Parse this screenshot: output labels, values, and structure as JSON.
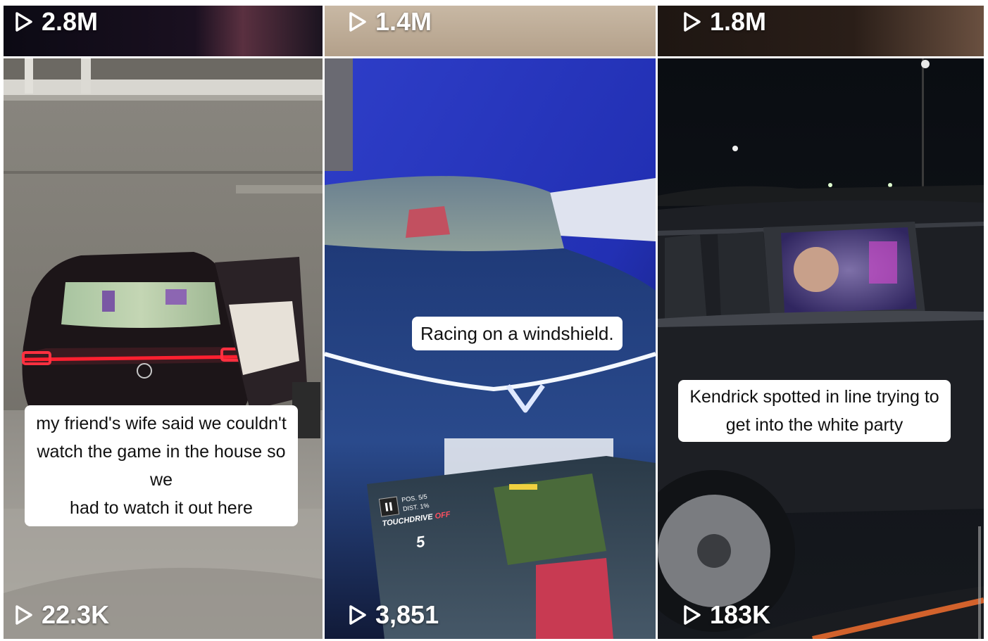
{
  "top_row": [
    {
      "views": "2.8M"
    },
    {
      "views": "1.4M"
    },
    {
      "views": "1.8M"
    }
  ],
  "tiles": [
    {
      "views": "22.3K",
      "caption_lines": [
        "my friend's wife said we couldn't",
        "watch the game in the house so we",
        "had to watch it out here"
      ]
    },
    {
      "views": "3,851",
      "caption_lines": [
        "Racing on a windshield."
      ],
      "hud": {
        "pos_label": "POS.",
        "pos_value": "5/5",
        "dist_label": "DIST.",
        "dist_value": "1%",
        "touchdrive": "TOUCHDRIVE",
        "touchdrive_state": "OFF",
        "position": "5"
      }
    },
    {
      "views": "183K",
      "caption_lines": [
        "Kendrick spotted in line trying to",
        "get into the white party"
      ]
    }
  ],
  "icons": {
    "play": "play-icon"
  }
}
